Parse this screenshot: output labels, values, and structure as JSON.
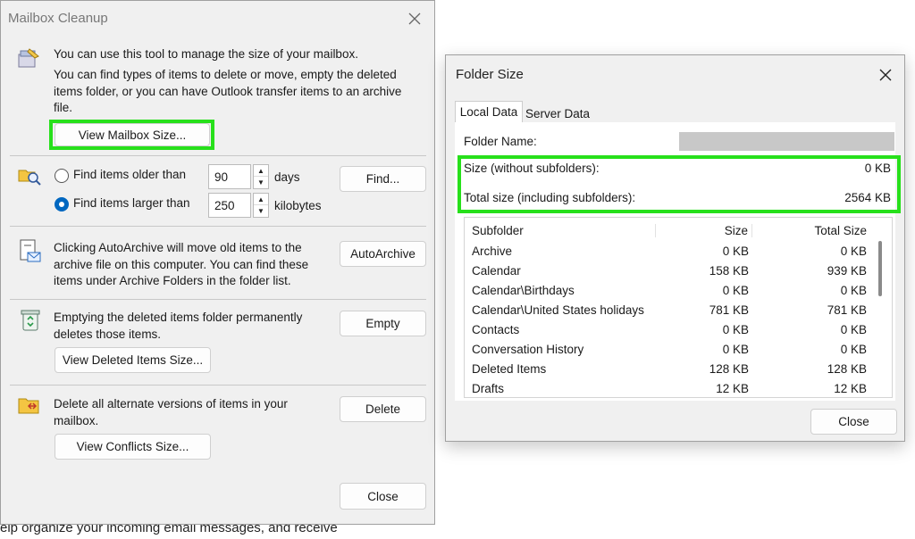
{
  "background_text": "elp organize your incoming email messages, and receive",
  "mailbox": {
    "title": "Mailbox Cleanup",
    "intro_line1": "You can use this tool to manage the size of your mailbox.",
    "intro_line2": "You can find types of items to delete or move, empty the deleted items folder, or you can have Outlook transfer items to an archive file.",
    "view_size_button": "View Mailbox Size...",
    "find_older_label": "Find items older than",
    "find_older_value": "90",
    "find_older_unit": "days",
    "find_larger_label": "Find items larger than",
    "find_larger_value": "250",
    "find_larger_unit": "kilobytes",
    "selected_option": "larger",
    "find_button": "Find...",
    "autoarchive_text": "Clicking AutoArchive will move old items to the archive file on this computer. You can find these items under Archive Folders in the folder list.",
    "autoarchive_button": "AutoArchive",
    "empty_text": "Emptying the deleted items folder permanently deletes those items.",
    "empty_button": "Empty",
    "view_deleted_button": "View Deleted Items Size...",
    "delete_text": "Delete all alternate versions of items in your mailbox.",
    "delete_button": "Delete",
    "view_conflicts_button": "View Conflicts Size...",
    "close_button": "Close"
  },
  "folder_size": {
    "title": "Folder Size",
    "tabs": [
      "Local Data",
      "Server Data"
    ],
    "active_tab": "Local Data",
    "folder_name_label": "Folder Name:",
    "size_label": "Size (without subfolders):",
    "size_value": "0 KB",
    "total_label": "Total size (including subfolders):",
    "total_value": "2564 KB",
    "columns": [
      "Subfolder",
      "Size",
      "Total Size"
    ],
    "rows": [
      [
        "Archive",
        "0 KB",
        "0 KB"
      ],
      [
        "Calendar",
        "158 KB",
        "939 KB"
      ],
      [
        "Calendar\\Birthdays",
        "0 KB",
        "0 KB"
      ],
      [
        "Calendar\\United States holidays",
        "781 KB",
        "781 KB"
      ],
      [
        "Contacts",
        "0 KB",
        "0 KB"
      ],
      [
        "Conversation History",
        "0 KB",
        "0 KB"
      ],
      [
        "Deleted Items",
        "128 KB",
        "128 KB"
      ],
      [
        "Drafts",
        "12 KB",
        "12 KB"
      ]
    ],
    "close_button": "Close"
  },
  "colors": {
    "highlight": "#27e01b",
    "accent": "#0067c0"
  }
}
